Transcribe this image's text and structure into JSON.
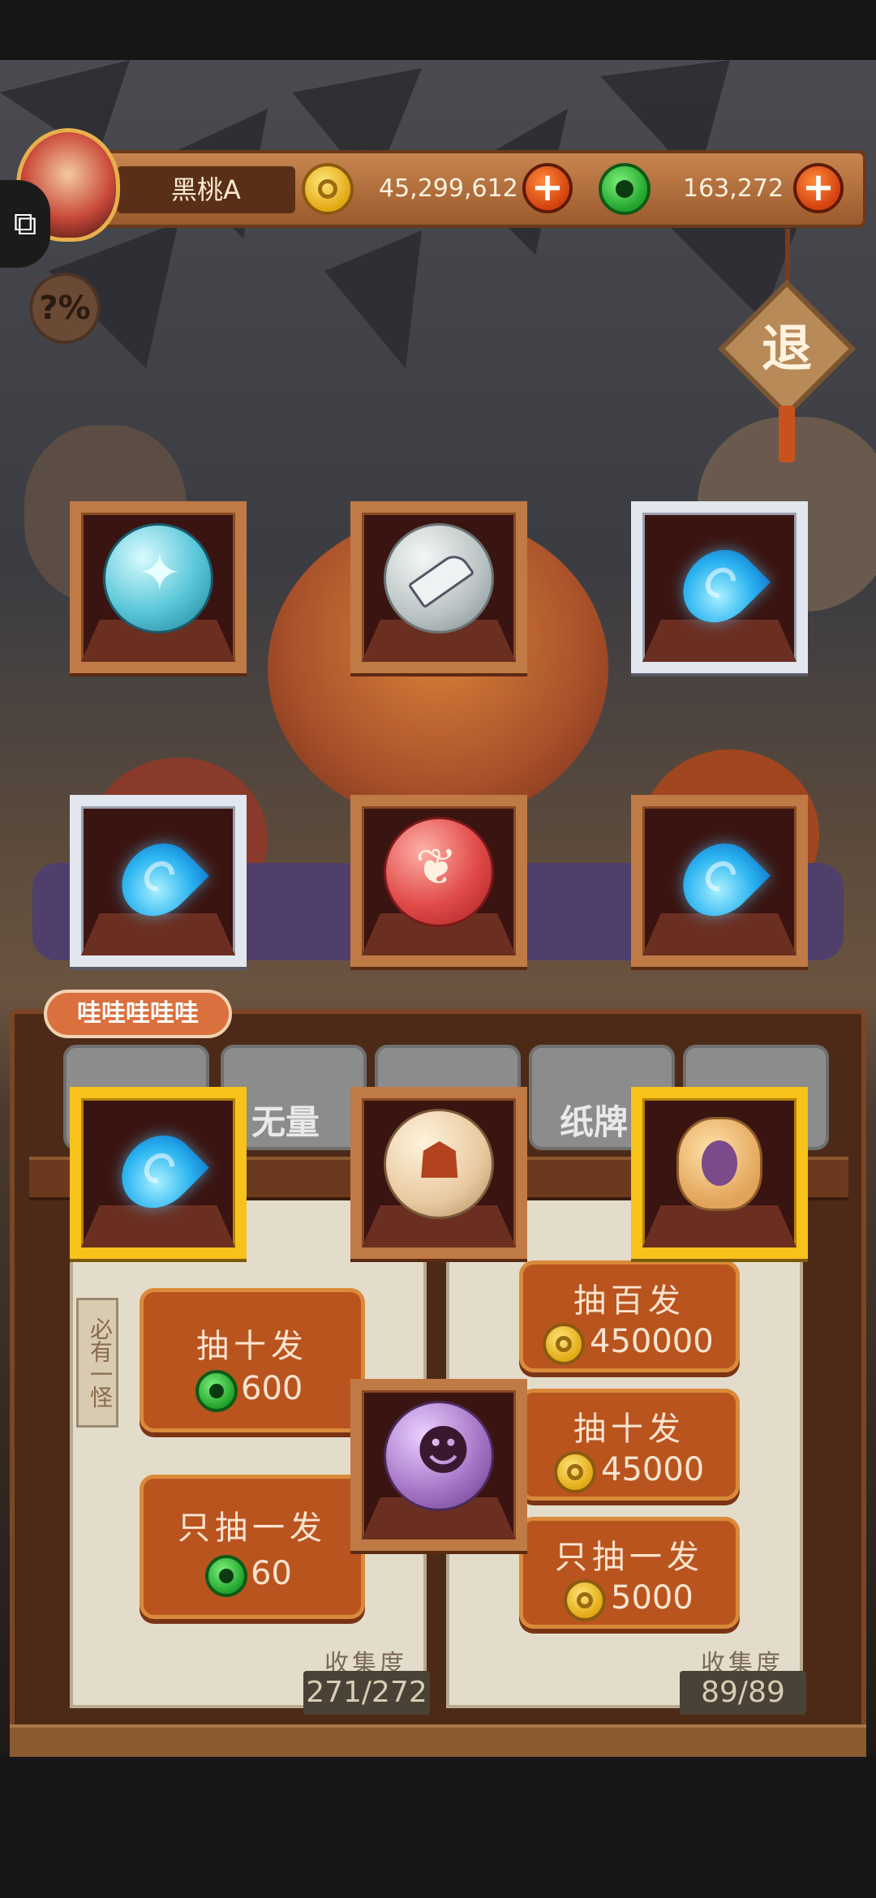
{
  "header": {
    "player_name": "黑桃A",
    "gold_amount": "45,299,612",
    "jade_amount": "163,272",
    "plus_label": "+"
  },
  "side": {
    "help_label": "?%",
    "exit_label": "退"
  },
  "machine": {
    "speech_bubble": "哇哇哇哇哇",
    "tabs": [
      {
        "label": ""
      },
      {
        "label": "无量"
      },
      {
        "label": ""
      },
      {
        "label": "纸牌"
      },
      {
        "label": ""
      }
    ],
    "hang_tag": "必有一怪",
    "left_pool": {
      "draw_ten": {
        "title": "抽十发",
        "cost": "600"
      },
      "draw_one": {
        "title": "只抽一发",
        "cost": "60"
      },
      "collection_title": "收集度",
      "collection_count": "271/272"
    },
    "right_pool": {
      "draw_hundred": {
        "title": "抽百发",
        "cost": "450000"
      },
      "draw_ten": {
        "title": "抽十发",
        "cost": "45000"
      },
      "draw_one": {
        "title": "只抽一发",
        "cost": "5000"
      },
      "collection_title": "收集度",
      "collection_count": "89/89"
    }
  },
  "prizes": [
    {
      "item": "ice-crystal-orb",
      "rarity": "bronze"
    },
    {
      "item": "cleaver-orb",
      "rarity": "bronze"
    },
    {
      "item": "blue-soul-flame",
      "rarity": "silver"
    },
    {
      "item": "blue-soul-flame",
      "rarity": "silver"
    },
    {
      "item": "red-wing-orb",
      "rarity": "bronze"
    },
    {
      "item": "blue-soul-flame",
      "rarity": "bronze"
    },
    {
      "item": "blue-soul-flame",
      "rarity": "gold"
    },
    {
      "item": "monk-orb",
      "rarity": "bronze"
    },
    {
      "item": "purple-demon-token",
      "rarity": "gold"
    },
    {
      "item": "purple-mask-orb",
      "rarity": "bronze"
    }
  ],
  "colors": {
    "bronze_frame": "#c07a45",
    "silver_frame": "#e2e6ef",
    "gold_frame": "#f7c21a",
    "button_orange": "#b9541f"
  }
}
